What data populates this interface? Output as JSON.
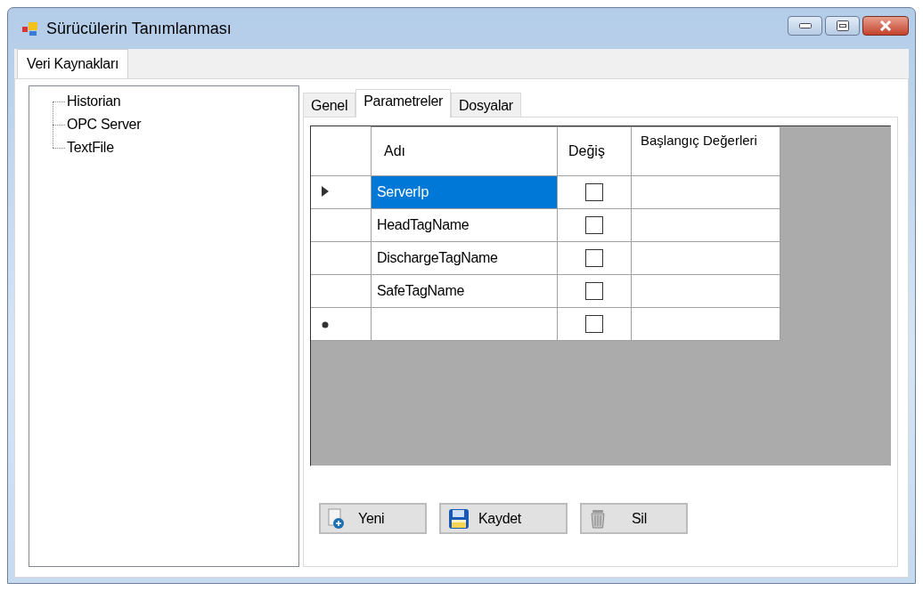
{
  "window": {
    "title": "Sürücülerin Tanımlanması"
  },
  "outer_tabs": [
    {
      "label": "Veri Kaynakları",
      "selected": true
    }
  ],
  "tree": {
    "items": [
      {
        "label": "Historian"
      },
      {
        "label": "OPC Server"
      },
      {
        "label": "TextFile"
      }
    ]
  },
  "inner_tabs": [
    {
      "label": "Genel",
      "selected": false
    },
    {
      "label": "Parametreler",
      "selected": true
    },
    {
      "label": "Dosyalar",
      "selected": false
    }
  ],
  "grid": {
    "columns": [
      "Adı",
      "Değiş",
      "Başlangıç Değerleri"
    ],
    "rows": [
      {
        "kind": "current",
        "name": "ServerIp",
        "selected": true,
        "checked": false
      },
      {
        "kind": "plain",
        "name": "HeadTagName",
        "selected": false,
        "checked": false
      },
      {
        "kind": "plain",
        "name": "DischargeTagName",
        "selected": false,
        "checked": false
      },
      {
        "kind": "plain",
        "name": "SafeTagName",
        "selected": false,
        "checked": false
      },
      {
        "kind": "new",
        "selected": false,
        "checked": false
      }
    ]
  },
  "buttons": [
    {
      "label": "Yeni",
      "kind": "new"
    },
    {
      "label": "Kaydet",
      "kind": "save"
    },
    {
      "label": "Sil",
      "kind": "delete"
    }
  ]
}
